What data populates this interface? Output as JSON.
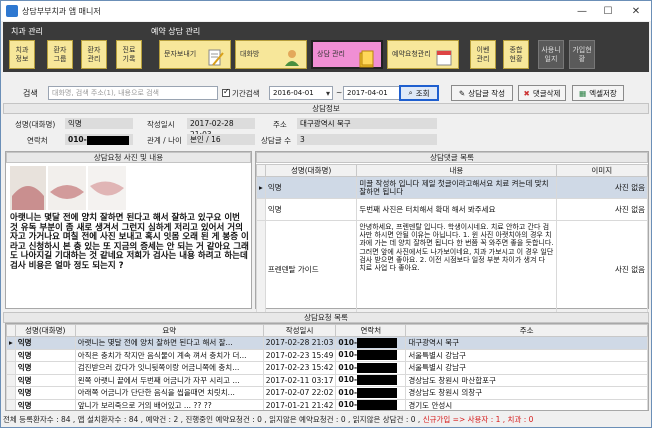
{
  "window": {
    "title": "상담부부치과 앱 매니저"
  },
  "toolbar": {
    "group1_label": "치과 관리",
    "group2_label": "예약 상담 관리",
    "clinic_info": "치과\n정보",
    "doctor_group": "환자\n그룹",
    "patient_mgmt": "환자\n관리",
    "records": "진료\n기록",
    "sms_send": "문자보내기",
    "consult": "대화방",
    "consult_mgmt": "상담 관리",
    "reservation_mgmt": "예약요청관리",
    "event_mgmt": "이벤\n관리",
    "stats": "종합\n현황",
    "usage_guide": "사용니\n일지",
    "join_status": "가입현\n황"
  },
  "search": {
    "label": "검색",
    "placeholder": "대화명, 검색 주소(1), 내용으로 검색",
    "period_label": "기간검색",
    "date_from": "2016-04-01",
    "date_to": "2017-04-01",
    "search_btn": "조회",
    "write_btn": "상담글 작성",
    "delete_btn": "댓글삭제",
    "excel_btn": "엑셀저장"
  },
  "info": {
    "header": "상담정보",
    "name_label": "성명(대화명)",
    "name_value": "익명",
    "date_label": "작성일시",
    "date_value": "2017-02-28 21:03",
    "addr_label": "주소",
    "addr_value": "대구광역시 북구",
    "contact_label": "연락처",
    "contact_value": "010-",
    "relation_label": "관계 / 나이",
    "relation_value": "본인 / 16",
    "count_label": "상담글 수",
    "count_value": "3"
  },
  "photo_section": {
    "header": "상담요청 사진 및 내용",
    "message": "아랫니는 몇달 전에 양치 잘하면 된다고 해서 잘하고 있구요 이번 것 유독 부분이 좀 새로 생겨서 그런지 심하게 저리고 있어서 거의 자고 가거나요 며칠 전에 사진 보내고 혹시 잇몸 오래 된 게 봉증 이라고 신청하시 본 충 있는 또 지금의 증세는 안 되는 거 같아요 그래도 나아지길 기대하는 것 같네요 저희가 검사는 내용 하려고 하는데 검사 비용은 얼마 정도 되는지 ?"
  },
  "comments": {
    "header": "상담댓글 목록",
    "columns": [
      "성명(대화명)",
      "내용",
      "이미지"
    ],
    "rows": [
      {
        "name": "익명",
        "content": "미끌 작성하 입니다 제일 첫글이라고해서요 치료 켜는데 맞치 잘하면 됩니다",
        "image": "사진 없음"
      },
      {
        "name": "익명",
        "content": "두번째 사진은 터치해서 확대 해서 봐주세요",
        "image": "사진 없음"
      },
      {
        "name": "프렌덴탈 가이드",
        "content": "안녕하세요, 프렌덴탈 입니다. 학생이시네요. 치료 안하고 간다 검사만 하시면 안될 이유는 아닙니다. 1. 윈 사진 아랫치아의 경우 치과에 가는 데 양치 잘하면 됩니다 한 번쯤 꼭 와주면 좋을 듯합니다. 그러면 앞에 사진에서도 나가보이네요, 치과 가보시고 이 경우 일단 검사 받으면 좋아요. 2. 이전 시점보다 일정 부분 차이가 생겨 다 치료 사업 다 좋아요.",
        "image": "사진 없음"
      }
    ]
  },
  "list": {
    "header": "상담요청 목록",
    "columns": [
      "성명(대화명)",
      "요약",
      "작성일시",
      "연락처",
      "주소"
    ],
    "rows": [
      {
        "name": "익명",
        "summary": "아랫니는 몇달 전에 양치 잘하면 된다고 해서 잘...",
        "date": "2017-02-28 21:03",
        "contact": "010-",
        "addr": "대구광역시 북구"
      },
      {
        "name": "익명",
        "summary": "아직은 충치가 작지만 음식물이 계속 껴서 충치가 더...",
        "date": "2017-02-23 15:49",
        "contact": "010-",
        "addr": "서울특별시 강남구"
      },
      {
        "name": "익명",
        "summary": "검진받으러 갔다가 잇니뒷쪽이랑 어금니쪽에 충치...",
        "date": "2017-02-23 15:42",
        "contact": "010-",
        "addr": "서울특별시 강남구"
      },
      {
        "name": "익명",
        "summary": "왼쪽 아랫니 끝에서 두번째 어금니가 자꾸 시리고 ...",
        "date": "2017-02-11 03:17",
        "contact": "010-",
        "addr": "경상남도 창원시 마산합포구"
      },
      {
        "name": "익명",
        "summary": "아래쪽 어금니가 단단한 음식을 씹을때면 치릿치...",
        "date": "2017-02-07 22:02",
        "contact": "010-",
        "addr": "경상남도 창원시 의창구"
      },
      {
        "name": "익명",
        "summary": "앞니가 보리죽으로 거의 배어있고 ... ?? ??",
        "date": "2017-01-21 21:42",
        "contact": "010-",
        "addr": "경기도 안성시"
      }
    ]
  },
  "status": {
    "text": "전체 등록환자수 : 84 , 앱 설치환자수 : 84 , 예약건 : 2 , 진행중인 예약요청건 : 0 , 읽지않은 예약요청건 : 0 , 읽지않은 상담건 : 0 ,",
    "highlight": "신규가입 => 사용자 : 1 , 치과 : 0"
  },
  "colors": {
    "toolbar_bg": "#3a3a3a",
    "button_yellow": "#f7e79a",
    "active_pink": "#f08fd4",
    "selection": "#cfd9e6",
    "status_red": "#d61a1a"
  }
}
